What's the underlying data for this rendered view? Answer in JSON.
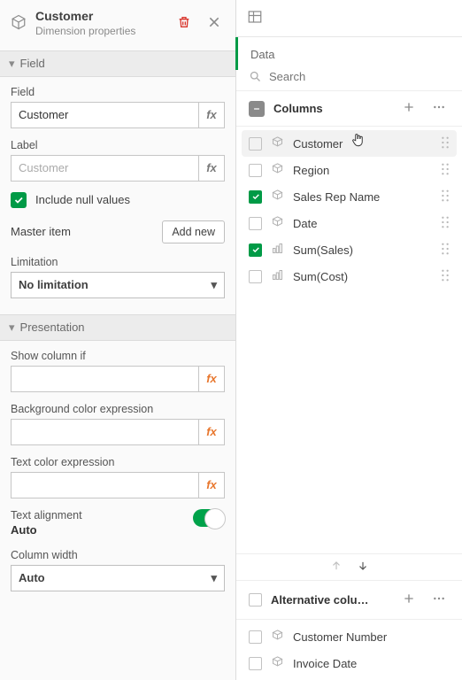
{
  "header": {
    "title": "Customer",
    "subtitle": "Dimension properties"
  },
  "fieldSection": {
    "title": "Field",
    "fieldLabel": "Field",
    "fieldValue": "Customer",
    "labelLabel": "Label",
    "labelPlaceholder": "Customer",
    "includeNullLabel": "Include null values",
    "masterItemLabel": "Master item",
    "addNewLabel": "Add new",
    "limitationLabel": "Limitation",
    "limitationValue": "No limitation"
  },
  "presentationSection": {
    "title": "Presentation",
    "showColumnIfLabel": "Show column if",
    "bgExprLabel": "Background color expression",
    "textExprLabel": "Text color expression",
    "textAlignLabel": "Text alignment",
    "textAlignValue": "Auto",
    "colWidthLabel": "Column width",
    "colWidthValue": "Auto"
  },
  "dataPanel": {
    "tabLabel": "Data",
    "searchPlaceholder": "Search",
    "columnsLabel": "Columns",
    "altColumnsLabel": "Alternative colu…",
    "columns": [
      {
        "label": "Customer",
        "checked": false,
        "type": "dim",
        "hovered": true
      },
      {
        "label": "Region",
        "checked": false,
        "type": "dim"
      },
      {
        "label": "Sales Rep Name",
        "checked": true,
        "type": "dim"
      },
      {
        "label": "Date",
        "checked": false,
        "type": "dim"
      },
      {
        "label": "Sum(Sales)",
        "checked": true,
        "type": "measure"
      },
      {
        "label": "Sum(Cost)",
        "checked": false,
        "type": "measure"
      }
    ],
    "altColumns": [
      {
        "label": "Customer Number",
        "type": "dim"
      },
      {
        "label": "Invoice Date",
        "type": "dim"
      }
    ]
  }
}
